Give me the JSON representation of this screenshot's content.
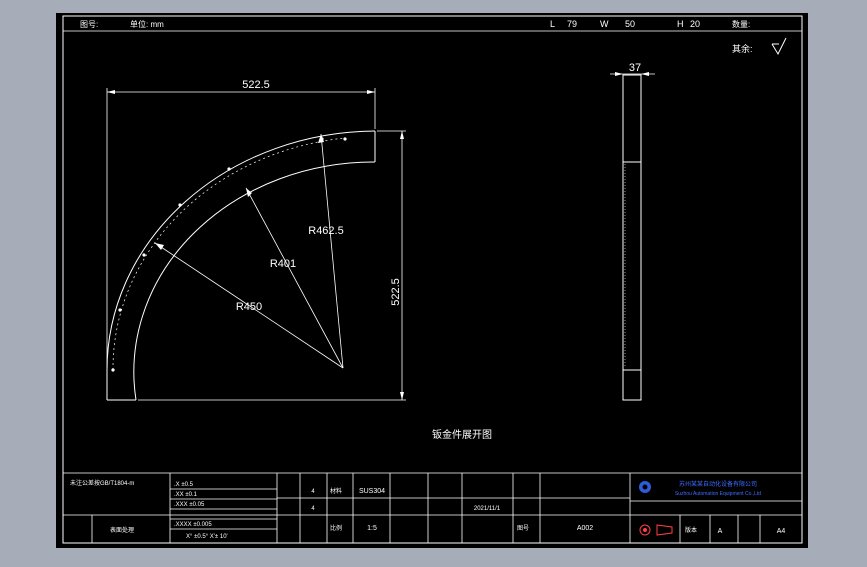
{
  "header": {
    "field_1": "图号:",
    "field_2": "单位: mm",
    "dim_l_label": "L",
    "dim_l_value": "79",
    "dim_w_label": "W",
    "dim_w_value": "50",
    "dim_h_label": "H",
    "dim_h_value": "20",
    "quantity_label": "数量:"
  },
  "surface_note": "其余:",
  "dimensions": {
    "width": "522.5",
    "height": "522.5",
    "thickness": "37",
    "radius_outer": "R462.5",
    "radius_inner": "R401",
    "radius_mid": "R450"
  },
  "technical_note": "钣金件展开图",
  "title_block": {
    "tolerance_title": "未注公差按GB/T1804-m",
    "tol_row_1": ".X   ±0.5",
    "tol_row_2": ".XX  ±0.1",
    "tol_row_3": ".XXX ±0.05",
    "tol_row_4": ".XXXX ±0.005",
    "angle_row": "X° ±0.5°   X'± 10'",
    "surface_label": "表面处理",
    "material_label": "材料",
    "material_value": "SUS304",
    "quantity_value": "4",
    "scale_label": "比例",
    "scale_value": "1:5",
    "date_value": "2021/11/1",
    "drawing_no_label": "图号",
    "drawing_no_value": "A002",
    "company_name": "苏州某某自动化设备有限公司",
    "company_en": "Suzhou Automation Equipment Co.,Ltd",
    "sheet_size": "A4",
    "revision": "A",
    "version_label": "版本"
  }
}
